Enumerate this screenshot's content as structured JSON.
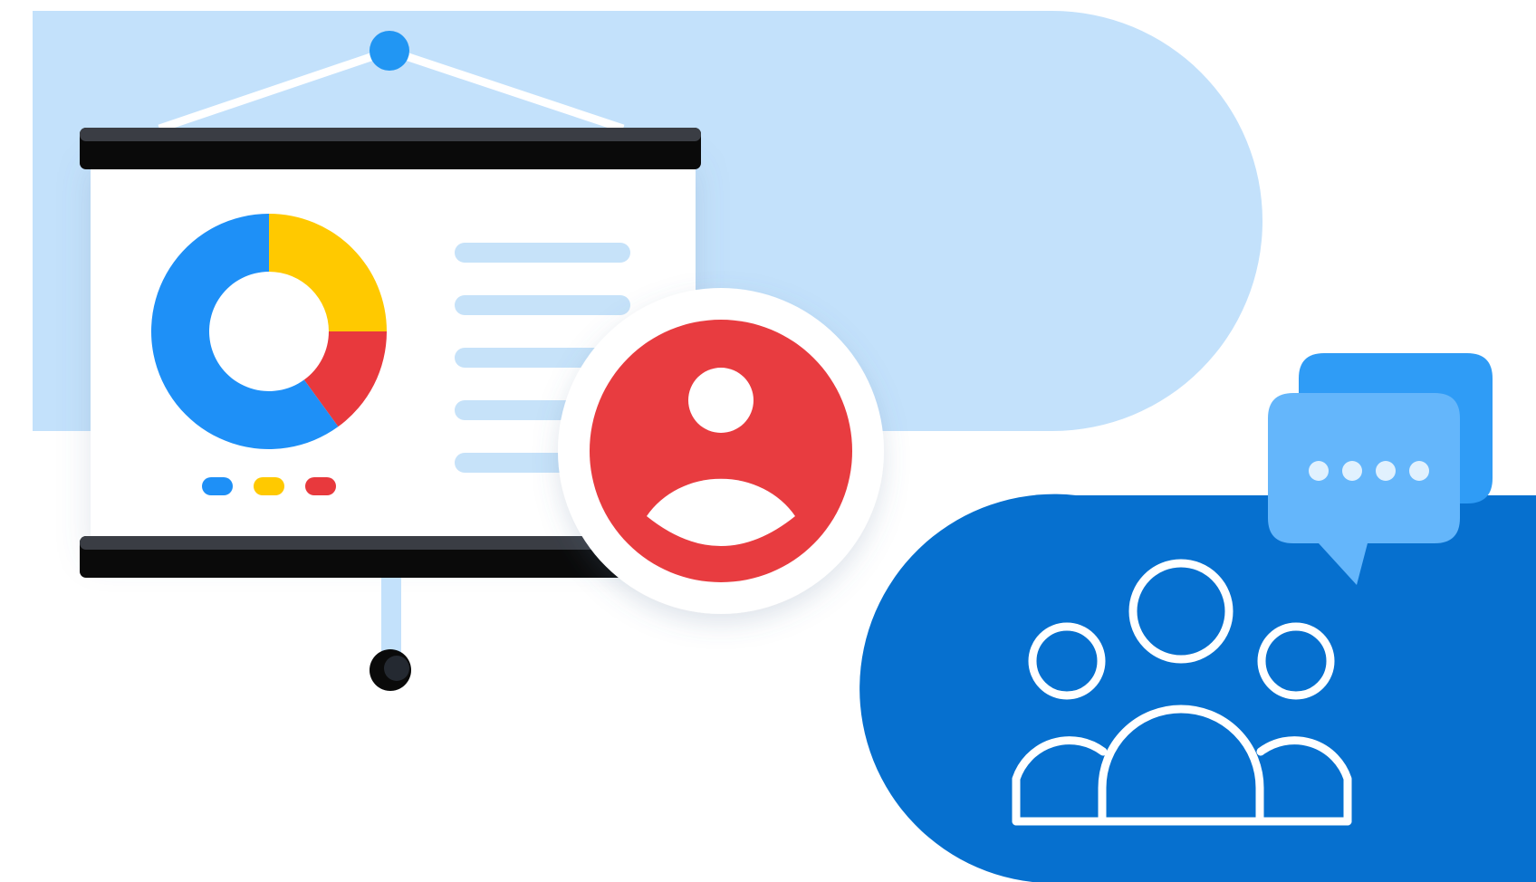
{
  "illustration": {
    "theme": "presentation-and-team-collaboration",
    "colors": {
      "background": "#ffffff",
      "light_blue_panel": "#c3e1fb",
      "dark_blue_panel": "#0670cf",
      "screen_bar": "#0a0a0a",
      "screen_bar_top": "#3a3d44",
      "screen": "#ffffff",
      "text_lines": "#c6e2f9",
      "pole": "#c3e1fb",
      "hanger_knob": "#2196f3",
      "donut_blue": "#1e90f7",
      "donut_yellow": "#ffc900",
      "donut_red": "#e8393d",
      "avatar_ring": "#ffffff",
      "avatar_fill": "#e83c40",
      "chat_back": "#2f9cf6",
      "chat_front": "#64b6fb",
      "chat_dots": "#e1f1fe",
      "people_outline": "#ffffff"
    },
    "chart": {
      "segments": [
        {
          "color": "#ffc900",
          "fraction": 0.25
        },
        {
          "color": "#e8393d",
          "fraction": 0.15
        },
        {
          "color": "#1e90f7",
          "fraction": 0.6
        }
      ],
      "legend_dots": [
        "#1e90f7",
        "#ffc900",
        "#e8393d"
      ]
    },
    "text_line_count": 5,
    "chat_dot_count": 4,
    "icons": {
      "avatar": "user-avatar-icon",
      "chat": "chat-bubbles-icon",
      "group": "people-group-icon"
    }
  }
}
